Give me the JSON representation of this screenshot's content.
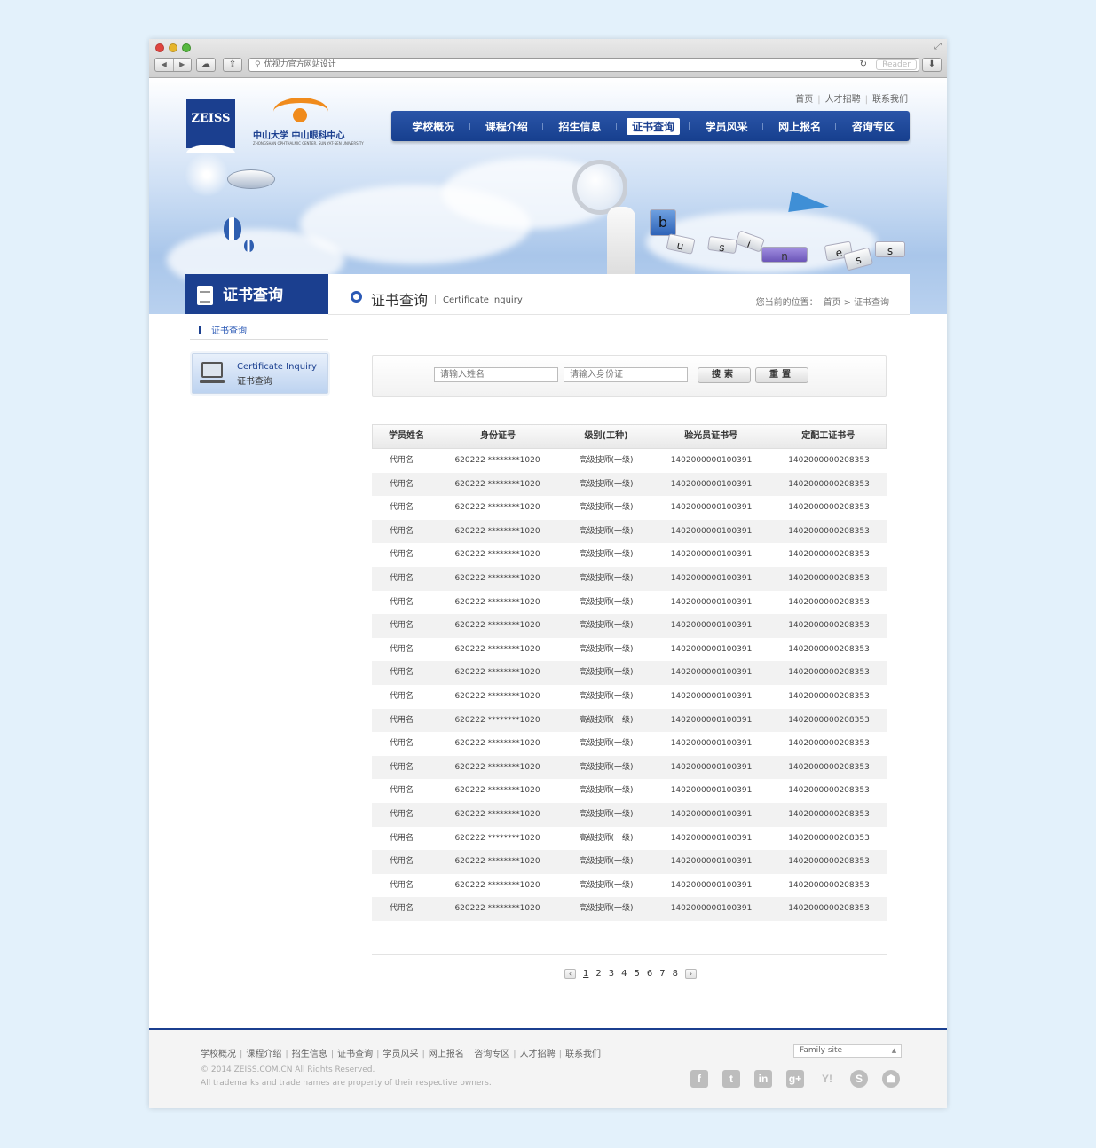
{
  "browser": {
    "url": "优视力官方网站设计",
    "reader_label": "Reader",
    "back_icon": "back-arrow-icon",
    "forward_icon": "forward-arrow-icon"
  },
  "header": {
    "brand": "ZEISS",
    "logo_text": "中山大学 中山眼科中心",
    "logo_subtext": "ZHONGSHAN OPHTHALMIC CENTER, SUN YAT-SEN UNIVERSITY",
    "top_links": [
      "首页",
      "人才招聘",
      "联系我们"
    ],
    "nav": [
      "学校概况",
      "课程介绍",
      "招生信息",
      "证书查询",
      "学员风采",
      "网上报名",
      "咨询专区"
    ],
    "active_nav": "证书查询",
    "banner_letters": [
      "b",
      "u",
      "s",
      "i",
      "n",
      "e",
      "s",
      "s"
    ]
  },
  "section": {
    "tab_title": "证书查询",
    "title": "证书查询",
    "title_en": "Certificate inquiry",
    "breadcrumb_label": "您当前的位置：",
    "breadcrumb": [
      "首页",
      "证书查询"
    ]
  },
  "sidebar": {
    "link": "证书查询",
    "card_en": "Certificate Inquiry",
    "card_cn": "证书查询"
  },
  "search": {
    "name_placeholder": "请输入姓名",
    "id_placeholder": "请输入身份证",
    "search_label": "搜索",
    "reset_label": "重置"
  },
  "table": {
    "headers": [
      "学员姓名",
      "身份证号",
      "级别(工种)",
      "验光员证书号",
      "定配工证书号"
    ],
    "rows": [
      [
        "代用名",
        "620222 ********1020",
        "高级技师(一级)",
        "1402000000100391",
        "1402000000208353"
      ],
      [
        "代用名",
        "620222 ********1020",
        "高级技师(一级)",
        "1402000000100391",
        "1402000000208353"
      ],
      [
        "代用名",
        "620222 ********1020",
        "高级技师(一级)",
        "1402000000100391",
        "1402000000208353"
      ],
      [
        "代用名",
        "620222 ********1020",
        "高级技师(一级)",
        "1402000000100391",
        "1402000000208353"
      ],
      [
        "代用名",
        "620222 ********1020",
        "高级技师(一级)",
        "1402000000100391",
        "1402000000208353"
      ],
      [
        "代用名",
        "620222 ********1020",
        "高级技师(一级)",
        "1402000000100391",
        "1402000000208353"
      ],
      [
        "代用名",
        "620222 ********1020",
        "高级技师(一级)",
        "1402000000100391",
        "1402000000208353"
      ],
      [
        "代用名",
        "620222 ********1020",
        "高级技师(一级)",
        "1402000000100391",
        "1402000000208353"
      ],
      [
        "代用名",
        "620222 ********1020",
        "高级技师(一级)",
        "1402000000100391",
        "1402000000208353"
      ],
      [
        "代用名",
        "620222 ********1020",
        "高级技师(一级)",
        "1402000000100391",
        "1402000000208353"
      ],
      [
        "代用名",
        "620222 ********1020",
        "高级技师(一级)",
        "1402000000100391",
        "1402000000208353"
      ],
      [
        "代用名",
        "620222 ********1020",
        "高级技师(一级)",
        "1402000000100391",
        "1402000000208353"
      ],
      [
        "代用名",
        "620222 ********1020",
        "高级技师(一级)",
        "1402000000100391",
        "1402000000208353"
      ],
      [
        "代用名",
        "620222 ********1020",
        "高级技师(一级)",
        "1402000000100391",
        "1402000000208353"
      ],
      [
        "代用名",
        "620222 ********1020",
        "高级技师(一级)",
        "1402000000100391",
        "1402000000208353"
      ],
      [
        "代用名",
        "620222 ********1020",
        "高级技师(一级)",
        "1402000000100391",
        "1402000000208353"
      ],
      [
        "代用名",
        "620222 ********1020",
        "高级技师(一级)",
        "1402000000100391",
        "1402000000208353"
      ],
      [
        "代用名",
        "620222 ********1020",
        "高级技师(一级)",
        "1402000000100391",
        "1402000000208353"
      ],
      [
        "代用名",
        "620222 ********1020",
        "高级技师(一级)",
        "1402000000100391",
        "1402000000208353"
      ],
      [
        "代用名",
        "620222 ********1020",
        "高级技师(一级)",
        "1402000000100391",
        "1402000000208353"
      ]
    ]
  },
  "pager": {
    "prev": "‹",
    "next": "›",
    "pages": [
      "1",
      "2",
      "3",
      "4",
      "5",
      "6",
      "7",
      "8"
    ],
    "current": "1"
  },
  "footer": {
    "links": [
      "学校概况",
      "课程介绍",
      "招生信息",
      "证书查询",
      "学员风采",
      "网上报名",
      "咨询专区",
      "人才招聘",
      "联系我们"
    ],
    "copyright": "© 2014 ZEISS.COM.CN  All Rights Reserved.",
    "trademark": "All trademarks and trade names are property of their respective owners.",
    "family_site": "Family site",
    "social_icons": [
      "facebook-icon",
      "tumblr-icon",
      "linkedin-icon",
      "google-plus-icon",
      "yahoo-icon",
      "skype-icon",
      "android-icon"
    ]
  },
  "colors": {
    "brand_blue": "#1b3f8f",
    "accent_orange": "#f08b1c",
    "page_bg": "#e3f1fb"
  }
}
